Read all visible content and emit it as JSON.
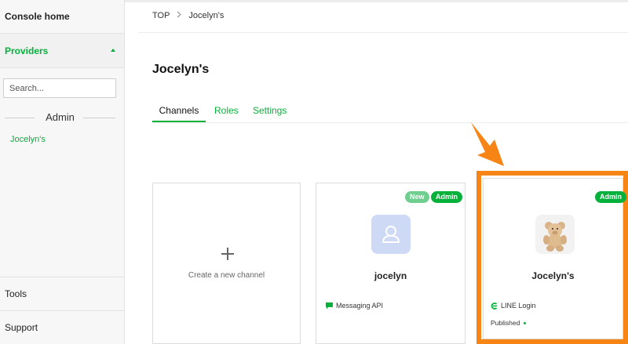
{
  "sidebar": {
    "console_home": "Console home",
    "providers": "Providers",
    "search_placeholder": "Search...",
    "admin_section": "Admin",
    "provider_item": "Jocelyn's",
    "tools": "Tools",
    "support": "Support"
  },
  "breadcrumb": {
    "root": "TOP",
    "current": "Jocelyn's"
  },
  "page": {
    "title": "Jocelyn's"
  },
  "tabs": [
    {
      "label": "Channels",
      "active": true
    },
    {
      "label": "Roles",
      "active": false
    },
    {
      "label": "Settings",
      "active": false
    }
  ],
  "cards": {
    "create": {
      "label": "Create a new channel"
    },
    "jocelyn": {
      "name": "jocelyn",
      "badge_new": "New",
      "badge_admin": "Admin",
      "type": "Messaging API",
      "type_icon": "chat-bubble-icon"
    },
    "jocelyns": {
      "name": "Jocelyn's",
      "badge_admin": "Admin",
      "type": "LINE Login",
      "type_icon": "line-login-icon",
      "status": "Published"
    }
  },
  "colors": {
    "accent": "#06b13b",
    "highlight": "#f68516"
  }
}
